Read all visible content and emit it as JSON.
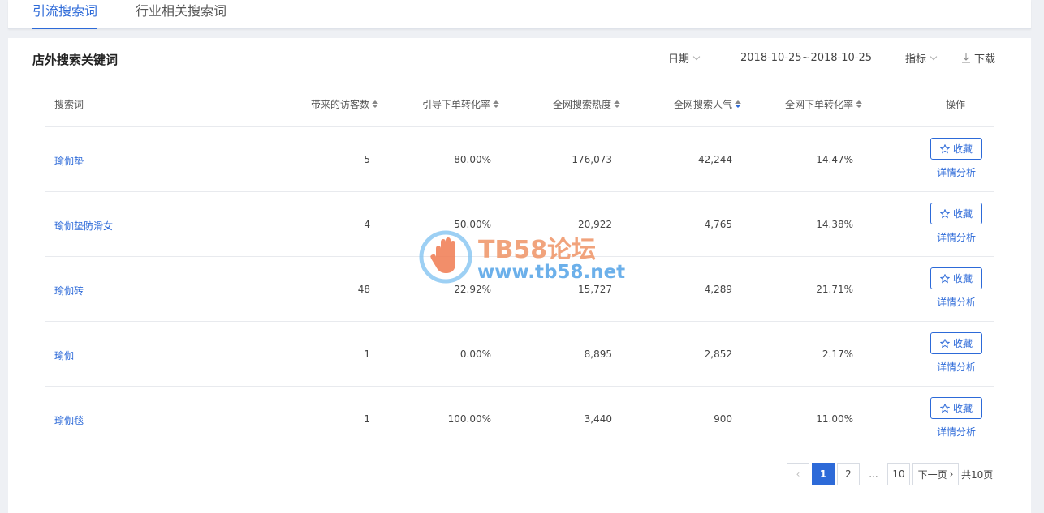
{
  "tabs": [
    {
      "label": "引流搜索词",
      "active": true
    },
    {
      "label": "行业相关搜索词",
      "active": false
    }
  ],
  "panel": {
    "title": "店外搜索关键词",
    "date_label": "日期",
    "date_range": "2018-10-25~2018-10-25",
    "metric_label": "指标",
    "download_label": "下载"
  },
  "table": {
    "headers": [
      "搜索词",
      "带来的访客数",
      "引导下单转化率",
      "全网搜索热度",
      "全网搜索人气",
      "全网下单转化率",
      "操作"
    ],
    "rows": [
      {
        "keyword": "瑜伽垫",
        "visitors": "5",
        "conv": "80.00%",
        "heat": "176,073",
        "popularity": "42,244",
        "net_conv": "14.47%"
      },
      {
        "keyword": "瑜伽垫防滑女",
        "visitors": "4",
        "conv": "50.00%",
        "heat": "20,922",
        "popularity": "4,765",
        "net_conv": "14.38%"
      },
      {
        "keyword": "瑜伽砖",
        "visitors": "48",
        "conv": "22.92%",
        "heat": "15,727",
        "popularity": "4,289",
        "net_conv": "21.71%"
      },
      {
        "keyword": "瑜伽",
        "visitors": "1",
        "conv": "0.00%",
        "heat": "8,895",
        "popularity": "2,852",
        "net_conv": "2.17%"
      },
      {
        "keyword": "瑜伽毯",
        "visitors": "1",
        "conv": "100.00%",
        "heat": "3,440",
        "popularity": "900",
        "net_conv": "11.00%"
      }
    ],
    "fav_label": "收藏",
    "detail_label": "详情分析"
  },
  "pager": {
    "prev": "‹",
    "pages": [
      "1",
      "2"
    ],
    "ellipsis": "...",
    "last": "10",
    "next": "下一页",
    "total": "共10页"
  },
  "watermark": {
    "title": "TB58论坛",
    "url": "www.tb58.net"
  },
  "colors": {
    "accent": "#2d6ad8",
    "watermark_orange": "#f09a6e",
    "watermark_blue": "#5da8e8"
  }
}
